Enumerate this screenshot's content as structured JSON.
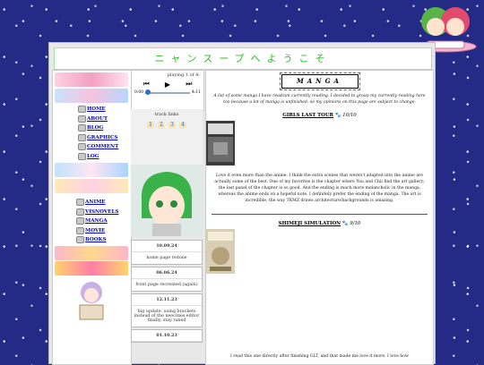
{
  "header": {
    "title": "ニャンスープへようこそ"
  },
  "nav": {
    "group1": [
      "HOME",
      "ABOUT",
      "BLOG",
      "GRAPHICS",
      "COMMENT",
      "LOG"
    ],
    "group2": [
      "ANIME",
      "VISNOVELS",
      "MANGA",
      "MOVIE",
      "BOOKS"
    ]
  },
  "player": {
    "status": "playing 1 of 4:",
    "time_current": "0:00",
    "time_total": "4:11",
    "progress": 0
  },
  "tracks": {
    "label": "track links",
    "numbers": [
      "1",
      "2",
      "3",
      "4"
    ]
  },
  "updates": [
    {
      "date": "10.09.24",
      "text": "home page redone"
    },
    {
      "date": "06.06.24",
      "text": "front page recreated (again)"
    },
    {
      "date": "12.11.23",
      "text": "big update. using brackets instead of the neocities editor finally. stay tuned"
    },
    {
      "date": "01.10.23",
      "text": ""
    }
  ],
  "main": {
    "heading": "MANGA",
    "intro": "A list of some manga I have read/am currently reading. I decided to group my currently-reading here too because a lot of manga is unfinished, so my opinions on this page are subject to change.",
    "entries": [
      {
        "title": "GIRLS LAST TOUR",
        "score": "10/10",
        "text": "Love it even more than the anime. I think the extra scenes that weren't adapted into the anime are actually some of the best. One of my favorites is the chapter where Yuu and Chii find the art gallery; the last panel of the chapter is so good. And the ending is much more melancholic in the manga, whereas the anime ends on a hopeful note. I definitely prefer the ending of the manga. The art is incredible, the way TKMZ draws architecture/backgrounds is amazing."
      },
      {
        "title": "SHIMEJI SIMULATION",
        "score": "9/10",
        "text": "I read this one directly after finishing GLT, and that made me love it more. I love how"
      }
    ]
  },
  "colors": {
    "page_bg": "#232b86",
    "header_text": "#27c027",
    "link": "#0000cc"
  }
}
